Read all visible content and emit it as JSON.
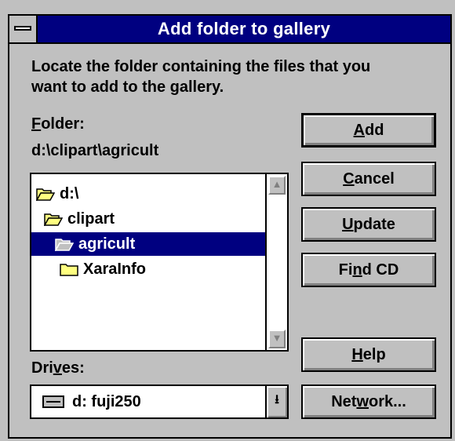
{
  "title": "Add folder to gallery",
  "intro": "Locate the folder containing the files that you want to add to the gallery.",
  "folder": {
    "label_prefix": "",
    "label_hotkey": "F",
    "label_rest": "older:",
    "path": "d:\\clipart\\agricult"
  },
  "tree": {
    "items": [
      {
        "label": "d:\\",
        "icon": "open-folder-icon"
      },
      {
        "label": "clipart",
        "icon": "open-folder-icon"
      },
      {
        "label": "agricult",
        "icon": "open-folder-icon",
        "selected": true
      },
      {
        "label": "XaraInfo",
        "icon": "closed-folder-icon"
      }
    ]
  },
  "buttons": {
    "add": {
      "pre": "",
      "key": "A",
      "post": "dd"
    },
    "cancel": {
      "pre": "",
      "key": "C",
      "post": "ancel"
    },
    "update": {
      "pre": "",
      "key": "U",
      "post": "pdate"
    },
    "find_cd": {
      "pre": "Fi",
      "key": "n",
      "post": "d CD"
    },
    "help": {
      "pre": "",
      "key": "H",
      "post": "elp"
    },
    "network": {
      "pre": "Net",
      "key": "w",
      "post": "ork..."
    }
  },
  "drives": {
    "label_pre": "Dri",
    "label_key": "v",
    "label_post": "es:",
    "selected": "d: fuji250"
  },
  "colors": {
    "title_bar": "#000080",
    "selection": "#000080",
    "face": "#c0c0c0"
  }
}
